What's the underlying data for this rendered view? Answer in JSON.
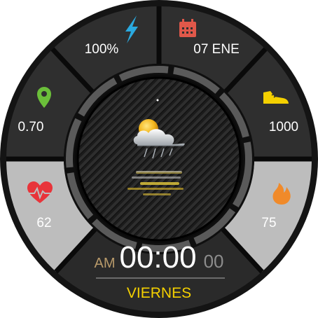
{
  "battery": {
    "value": "100%",
    "icon": "lightning-icon",
    "color": "#2aa9df"
  },
  "date": {
    "value": "07 ENE",
    "icon": "calendar-icon",
    "color": "#e0584a"
  },
  "distance": {
    "value": "0.70",
    "icon": "location-pin-icon",
    "color": "#6bbf3a"
  },
  "steps": {
    "value": "1000",
    "icon": "shoe-icon",
    "color": "#f4d000"
  },
  "heart_rate": {
    "value": "62",
    "icon": "heart-pulse-icon",
    "color": "#e8343a"
  },
  "calories": {
    "value": "75",
    "icon": "flame-icon",
    "color": "#f08a2a"
  },
  "weather": {
    "icon": "partly-cloudy-rain-icon"
  },
  "clock": {
    "ampm": "AM",
    "time": "00:00",
    "seconds": "00",
    "day": "VIERNES"
  }
}
